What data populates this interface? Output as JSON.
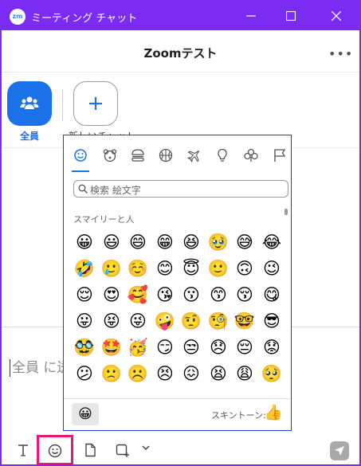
{
  "window": {
    "logo": "zm",
    "title": "ミーティング チャット",
    "accent": "#7b2cf2"
  },
  "header": {
    "title": "Zoomテスト",
    "more": "•••"
  },
  "recipients": {
    "everyone_label": "全員",
    "new_chat_label": "新しいチャット"
  },
  "compose": {
    "placeholder": "全員 に送信"
  },
  "toolbar": {
    "icons": [
      "text-format-icon",
      "emoji-icon",
      "file-icon",
      "screenshot-icon",
      "chevron-down-icon",
      "send-icon"
    ]
  },
  "emoji_picker": {
    "categories": [
      "smiley-icon",
      "bear-icon",
      "burger-icon",
      "basketball-icon",
      "airplane-icon",
      "lightbulb-icon",
      "club-icon",
      "flag-icon"
    ],
    "search_placeholder": "検索 絵文字",
    "section_title": "スマイリーと人",
    "rows": [
      [
        "😀",
        "😃",
        "😄",
        "😁",
        "😆",
        "🥹",
        "😅",
        "😂"
      ],
      [
        "🤣",
        "🥲",
        "☺️",
        "😊",
        "😇",
        "🙂",
        "🙃",
        "😉"
      ],
      [
        "😌",
        "😍",
        "🥰",
        "😘",
        "😗",
        "😙",
        "😚",
        "😋"
      ],
      [
        "😛",
        "😝",
        "😜",
        "🤪",
        "🤨",
        "🧐",
        "🤓",
        "😎"
      ],
      [
        "🥸",
        "🤩",
        "🥳",
        "😏",
        "😒",
        "😞",
        "😔",
        "😟"
      ],
      [
        "😕",
        "🙁",
        "☹️",
        "😣",
        "😖",
        "😫",
        "😩",
        "🥺"
      ]
    ],
    "recent_emoji": "😀",
    "skin_tone_label": "スキントーン:",
    "skin_tone_emoji": "👍"
  }
}
